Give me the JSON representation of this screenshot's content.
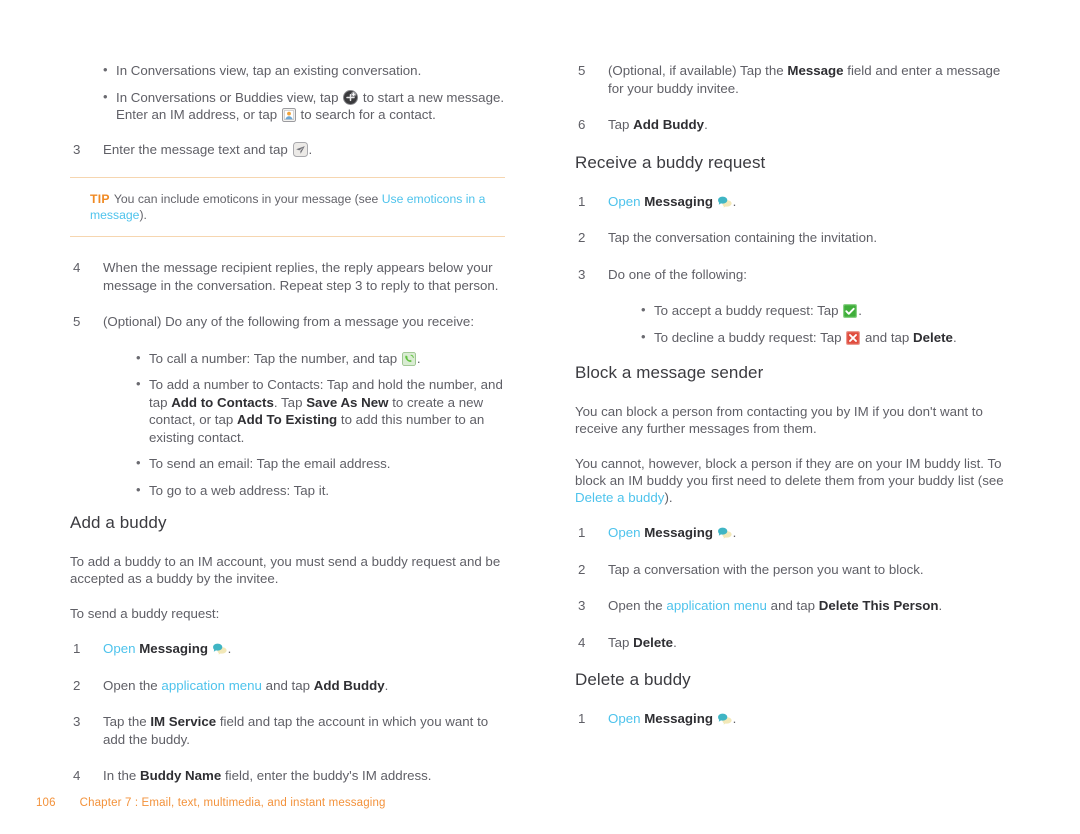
{
  "document": {
    "footer": {
      "page_number": "106",
      "chapter": "Chapter 7 :  Email, text, multimedia, and instant messaging"
    }
  },
  "left_column": {
    "bullets_top": [
      "In Conversations view, tap an existing conversation.",
      "In Conversations or Buddies view, tap"
    ],
    "bullet2_part2": "to start a new message. Enter an IM address, or tap",
    "bullet2_part3": "to search for a contact.",
    "step3": {
      "num": "3",
      "text_a": "Enter the message text and tap",
      "text_b": "."
    },
    "tip": {
      "label": "TIP",
      "text_a": "You can include emoticons in your message (see",
      "link": "Use emoticons in a message",
      "text_b": ")."
    },
    "step4": {
      "num": "4",
      "text": "When the message recipient replies, the reply appears below your message in the conversation. Repeat step 3 to reply to that person."
    },
    "step5": {
      "num": "5",
      "text": "(Optional) Do any of the following from a message you receive:"
    },
    "step5_bullets": {
      "b1_a": "To call a number: Tap the number, and tap",
      "b1_b": ".",
      "b2_a": "To add a number to Contacts: Tap and hold the number, and tap",
      "b2_bold1": "Add to Contacts",
      "b2_mid1": ". Tap",
      "b2_bold2": "Save As New",
      "b2_mid2": "to create a new contact, or tap",
      "b2_bold3": "Add To Existing",
      "b2_end": "to add this number to an existing contact.",
      "b3": "To send an email: Tap the email address.",
      "b4": "To go to a web address: Tap it."
    },
    "add_buddy": {
      "heading": "Add a buddy",
      "para1": "To add a buddy to an IM account, you must send a buddy request and be accepted as a buddy by the invitee.",
      "para2": "To send a buddy request:",
      "steps": [
        {
          "num": "1",
          "link": "Open",
          "bold": "Messaging",
          "end": "."
        },
        {
          "num": "2",
          "pre": "Open the",
          "link": "application menu",
          "mid": "and tap",
          "bold": "Add Buddy",
          "end": "."
        },
        {
          "num": "3",
          "pre": "Tap the",
          "bold": "IM Service",
          "post": "field and tap the account in which you want to add the buddy."
        },
        {
          "num": "4",
          "pre": "In the",
          "bold": "Buddy Name",
          "post": "field, enter the buddy's IM address."
        }
      ]
    }
  },
  "right_column": {
    "step5": {
      "num": "5",
      "pre": "(Optional, if available) Tap the",
      "bold": "Message",
      "post": "field and enter a message for your buddy invitee."
    },
    "step6": {
      "num": "6",
      "pre": "Tap",
      "bold": "Add Buddy",
      "end": "."
    },
    "receive_buddy_request": {
      "heading": "Receive a buddy request",
      "steps": [
        {
          "num": "1",
          "link": "Open",
          "bold": "Messaging",
          "end": "."
        },
        {
          "num": "2",
          "text": "Tap the conversation containing the invitation."
        },
        {
          "num": "3",
          "text": "Do one of the following:"
        }
      ],
      "bullets": {
        "accept_a": "To accept a buddy request: Tap",
        "accept_b": ".",
        "decline_a": "To decline a buddy request: Tap",
        "decline_mid": "and tap",
        "decline_bold": "Delete",
        "decline_end": "."
      }
    },
    "block_message_sender": {
      "heading": "Block a message sender",
      "para1": "You can block a person from contacting you by IM if you don't want to receive any further messages from them.",
      "para2_a": "You cannot, however, block a person if they are on your IM buddy list. To block an IM buddy you first need to delete them from your buddy list (see",
      "para2_link": "Delete a buddy",
      "para2_b": ").",
      "steps": [
        {
          "num": "1",
          "link": "Open",
          "bold": "Messaging",
          "end": "."
        },
        {
          "num": "2",
          "text": "Tap a conversation with the person you want to block."
        },
        {
          "num": "3",
          "pre": "Open the",
          "link": "application menu",
          "mid": "and tap",
          "bold": "Delete This Person",
          "end": "."
        },
        {
          "num": "4",
          "pre": "Tap",
          "bold": "Delete",
          "end": "."
        }
      ]
    },
    "delete_buddy": {
      "heading": "Delete a buddy",
      "steps": [
        {
          "num": "1",
          "link": "Open",
          "bold": "Messaging",
          "end": "."
        }
      ]
    }
  },
  "icons": {
    "new_message": "new-message-icon",
    "contact_search": "contact-search-icon",
    "send": "send-icon",
    "phone_call": "phone-call-icon",
    "messaging_app": "messaging-app-icon",
    "accept_check": "accept-check-icon",
    "decline_x": "decline-x-icon"
  },
  "colors": {
    "link": "#4ec3ec",
    "tip_label": "#f08a24",
    "footer": "#f3923b",
    "body_text": "#5f5f66",
    "bold_text": "#2f2f33",
    "accept_green": "#3fae3a",
    "decline_red": "#e04c3e"
  }
}
